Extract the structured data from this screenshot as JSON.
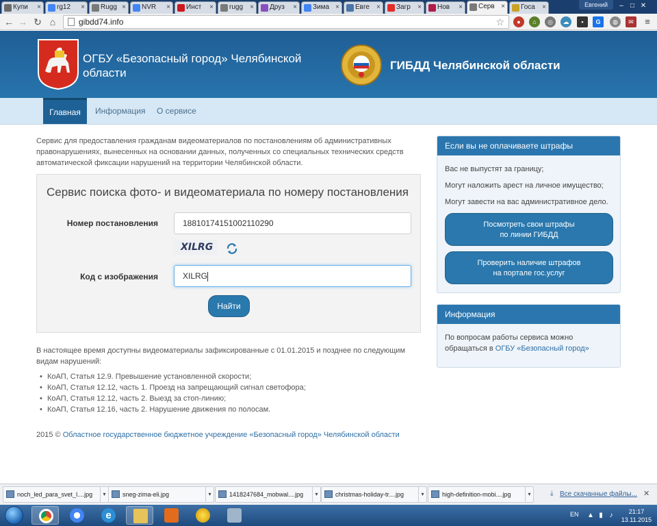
{
  "browser": {
    "tabs": [
      {
        "label": "Купи",
        "favicon": "mail-icon",
        "color": "#6b6b6b"
      },
      {
        "label": "rg12",
        "favicon": "google-icon",
        "color": "#4285f4"
      },
      {
        "label": "Rugg",
        "favicon": "page-icon",
        "color": "#7a7a7a"
      },
      {
        "label": "NVR",
        "favicon": "google-icon",
        "color": "#4285f4"
      },
      {
        "label": "Инст",
        "favicon": "youtube-icon",
        "color": "#cc181e"
      },
      {
        "label": "rugg",
        "favicon": "page-icon",
        "color": "#7a7a7a"
      },
      {
        "label": "Друз",
        "favicon": "s-icon",
        "color": "#8a4fbf"
      },
      {
        "label": "Зима",
        "favicon": "google-icon",
        "color": "#4285f4"
      },
      {
        "label": "Евге",
        "favicon": "vk-icon",
        "color": "#4a76a8"
      },
      {
        "label": "Загр",
        "favicon": "youtube-icon",
        "color": "#e52d27"
      },
      {
        "label": "Нов",
        "favicon": "d-icon",
        "color": "#b01c4a"
      },
      {
        "label": "Серв",
        "favicon": "page-icon",
        "color": "#7a7a7a",
        "active": true
      },
      {
        "label": "Госа",
        "favicon": "emblem-icon",
        "color": "#c9a227"
      }
    ],
    "profile_name": "Евгений",
    "url": "gibdd74.info"
  },
  "header": {
    "org_title": "ОГБУ «Безопасный город» Челябинской области",
    "gibdd_title": "ГИБДД Челябинской области"
  },
  "nav": {
    "items": [
      {
        "label": "Главная",
        "active": true
      },
      {
        "label": "Информация",
        "active": false
      },
      {
        "label": "О сервисе",
        "active": false
      }
    ]
  },
  "main": {
    "intro": "Сервис для предоставления гражданам видеоматериалов по постановлениям об административных правонарушениях, вынесенных на основании данных, полученных со специальных технических средств автоматической фиксации нарушений на территории Челябинской области.",
    "search": {
      "title": "Сервис поиска фото- и видеоматериала по номеру постановления",
      "resolution_label": "Номер постановления",
      "resolution_value": "18810174151002110290",
      "captcha_text": "XILRG",
      "code_label": "Код с изображения",
      "code_value": "XILRG",
      "submit_label": "Найти"
    },
    "available_text": "В настоящее время доступны видеоматериалы зафиксированные с 01.01.2015 и позднее по следующим видам нарушений:",
    "violations": [
      "КоАП, Статья 12.9. Превышение установленной скорости;",
      "КоАП, Статья 12.12, часть 1. Проезд на запрещающий сигнал светофора;",
      "КоАП, Статья 12.12, часть 2. Выезд за стоп-линию;",
      "КоАП, Статья 12.16, часть 2. Нарушение движения по полосам."
    ],
    "footer_year": "2015 ©",
    "footer_link": "Областное государственное бюджетное учреждение «Безопасный город» Челябинской области"
  },
  "sidebar": {
    "fines_card": {
      "title": "Если вы не оплачиваете штрафы",
      "lines": [
        "Вас не выпустят за границу;",
        "Могут наложить арест на личное имущество;",
        "Могут завести на вас административное дело."
      ],
      "button1_line1": "Посмотреть свои штрафы",
      "button1_line2": "по линии ГИБДД",
      "button2_line1": "Проверить наличие штрафов",
      "button2_line2": "на портале гос.услуг"
    },
    "info_card": {
      "title": "Информация",
      "text": "По вопросам работы сервиса можно обращаться в",
      "link": "ОГБУ «Безопасный город»"
    }
  },
  "downloads": {
    "items": [
      "noch_led_para_svet_l....jpg",
      "sneg-zima-eli.jpg",
      "1418247684_mobwal....jpg",
      "christmas-holiday-tr....jpg",
      "high-definition-mobi....jpg"
    ],
    "all_label": "Все скачанные файлы..."
  },
  "taskbar": {
    "lang": "EN",
    "time": "21:17",
    "date": "13.11.2015"
  },
  "colors": {
    "header_blue": "#2874ad",
    "button_blue": "#2a78ad",
    "nav_bg": "#d6e8f5",
    "link": "#2e6fa5"
  }
}
